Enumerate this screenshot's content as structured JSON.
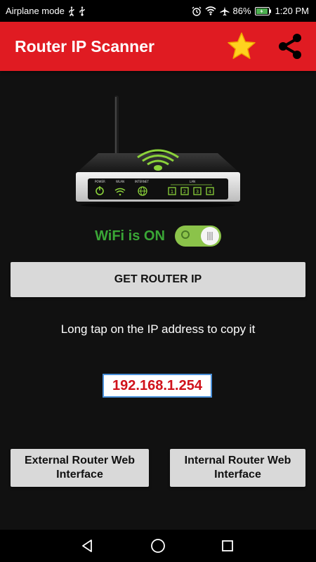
{
  "status_bar": {
    "mode_text": "Airplane mode",
    "battery_percent": "86%",
    "time": "1:20 PM",
    "icons": [
      "usb-icon",
      "usb-icon",
      "alarm-icon",
      "wifi-icon",
      "airplane-icon",
      "battery-charging-icon"
    ]
  },
  "app_bar": {
    "title": "Router IP Scanner",
    "background_color": "#e01b22",
    "actions": [
      "star-icon",
      "share-icon"
    ]
  },
  "wifi": {
    "status_label": "WiFi is ON",
    "toggle_on": true,
    "label_color": "#3aa636"
  },
  "get_ip_button": {
    "label": "GET ROUTER IP"
  },
  "hint": {
    "text": "Long tap on the IP address to copy it"
  },
  "ip": {
    "value": "192.168.1.254",
    "color": "#d0121b"
  },
  "buttons": {
    "external": "External Router Web Interface",
    "internal": "Internal Router Web Interface"
  },
  "router_panel": {
    "labels": [
      "POWER",
      "WLAN",
      "INTERNET",
      "LAN"
    ],
    "lan_ports": [
      "1",
      "2",
      "3",
      "4"
    ]
  },
  "nav": {
    "icons": [
      "back-icon",
      "home-icon",
      "recent-apps-icon"
    ]
  }
}
